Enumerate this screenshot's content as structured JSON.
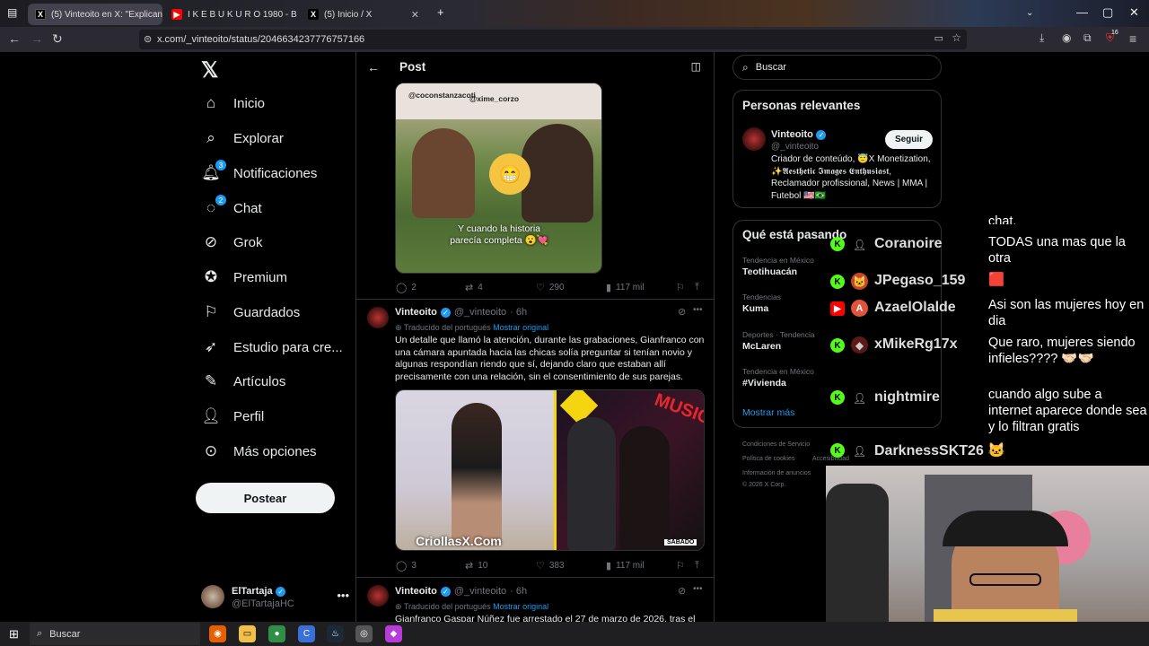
{
  "browser": {
    "tabs": [
      {
        "title": "(5) Vinteoito en X: \"Explicando",
        "active": true,
        "icon": "x-icon"
      },
      {
        "title": "I K E B U K U R O  1980 - B",
        "active": false,
        "icon": "youtube-icon"
      },
      {
        "title": "(5) Inicio / X",
        "active": false,
        "icon": "x-icon"
      }
    ],
    "url": "x.com/_vinteoito/status/2046634237776757166",
    "extension_badge": "16"
  },
  "nav": {
    "items": [
      {
        "label": "Inicio",
        "icon": "home-icon"
      },
      {
        "label": "Explorar",
        "icon": "search-icon"
      },
      {
        "label": "Notificaciones",
        "icon": "bell-icon",
        "badge": "3"
      },
      {
        "label": "Chat",
        "icon": "chat-icon",
        "badge": "2"
      },
      {
        "label": "Grok",
        "icon": "grok-icon"
      },
      {
        "label": "Premium",
        "icon": "premium-icon"
      },
      {
        "label": "Guardados",
        "icon": "bookmark-icon"
      },
      {
        "label": "Estudio para cre...",
        "icon": "rocket-icon"
      },
      {
        "label": "Artículos",
        "icon": "article-icon"
      },
      {
        "label": "Perfil",
        "icon": "person-icon"
      },
      {
        "label": "Más opciones",
        "icon": "more-circle-icon"
      }
    ],
    "post_button": "Postear",
    "account": {
      "name": "ElTartaja",
      "handle": "@ElTartajaHC"
    }
  },
  "post_header": {
    "title": "Post"
  },
  "tweets": [
    {
      "image_tags": [
        "@coconstanzacoti",
        "@xime_corzo"
      ],
      "image_caption": "Y cuando la historia\nparecía completa 😮💘",
      "replies": "2",
      "reposts": "4",
      "likes": "290",
      "views": "117 mil"
    },
    {
      "author": "Vinteoito",
      "handle": "@_vinteoito",
      "time": "· 6h",
      "translated": "Traducido del portugués",
      "show_original": "Mostrar original",
      "text": "Un detalle que llamó la atención, durante las grabaciones, Gianfranco con una cámara apuntada hacia las chicas solía preguntar si tenían novio y algunas respondían riendo que sí, dejando claro que estaban allí precisamente con una relación, sin el consentimiento de sus parejas.",
      "image_watermark": "CriollasX.Com",
      "image_label": "SÁBADO",
      "replies": "3",
      "reposts": "10",
      "likes": "383",
      "views": "117 mil"
    },
    {
      "author": "Vinteoito",
      "handle": "@_vinteoito",
      "time": "· 6h",
      "translated": "Traducido del portugués",
      "show_original": "Mostrar original",
      "text": "Gianfranco Gaspar Núñez fue arrestado el 27 de marzo de 2026, tras el"
    }
  ],
  "right": {
    "search_placeholder": "Buscar",
    "relevant": {
      "title": "Personas relevantes",
      "name": "Vinteoito",
      "handle": "@_vinteoito",
      "follow": "Seguir",
      "bio": "Criador de conteúdo, 😇X Monetization, ✨𝕬𝖊𝖘𝖙𝖍𝖊𝖙𝖎𝖈 𝕴𝖒𝖆𝖌𝖊𝖘 𝕰𝖓𝖙𝖍𝖚𝖘𝖎𝖆𝖘𝖙, Reclamador profissional, News | MMA | Futebol 🇺🇸🇧🇷"
    },
    "trends": {
      "title": "Qué está pasando",
      "items": [
        {
          "context": "Tendencia en México",
          "title": "Teotihuacán"
        },
        {
          "context": "Tendencias",
          "title": "Kuma"
        },
        {
          "context": "Deportes · Tendencia",
          "title": "McLaren"
        },
        {
          "context": "Tendencia en México",
          "title": "#Vivienda"
        }
      ],
      "show_more": "Mostrar más"
    },
    "footer": [
      "Condiciones de Servicio",
      "Política de cookies",
      "Accesibilidad",
      "Información de anuncios",
      "© 2026 X Corp."
    ]
  },
  "chat": {
    "top_fragment": "chat.",
    "messages": [
      {
        "platform": "kick",
        "user": "Coranoire",
        "text": "TODAS una mas que la otra"
      },
      {
        "platform": "kick",
        "user": "JPegaso_159",
        "text": "🟥"
      },
      {
        "platform": "youtube",
        "user": "AzaelOlalde",
        "text": "Asi son las mujeres hoy en dia"
      },
      {
        "platform": "kick",
        "user": "xMikeRg17x",
        "text": "Que raro, mujeres siendo infieles???? 🤝🏻🤝🏻"
      },
      {
        "platform": "kick",
        "user": "nightmire",
        "text": "cuando algo sube a internet aparece donde sea y lo filtran gratis"
      },
      {
        "platform": "kick",
        "user": "DarknessSKT26 🐱",
        "text": ""
      }
    ]
  },
  "taskbar": {
    "search_placeholder": "Buscar"
  },
  "colors": {
    "accent": "#1d9bf0",
    "kick": "#53fc18",
    "youtube": "#ff0000"
  }
}
